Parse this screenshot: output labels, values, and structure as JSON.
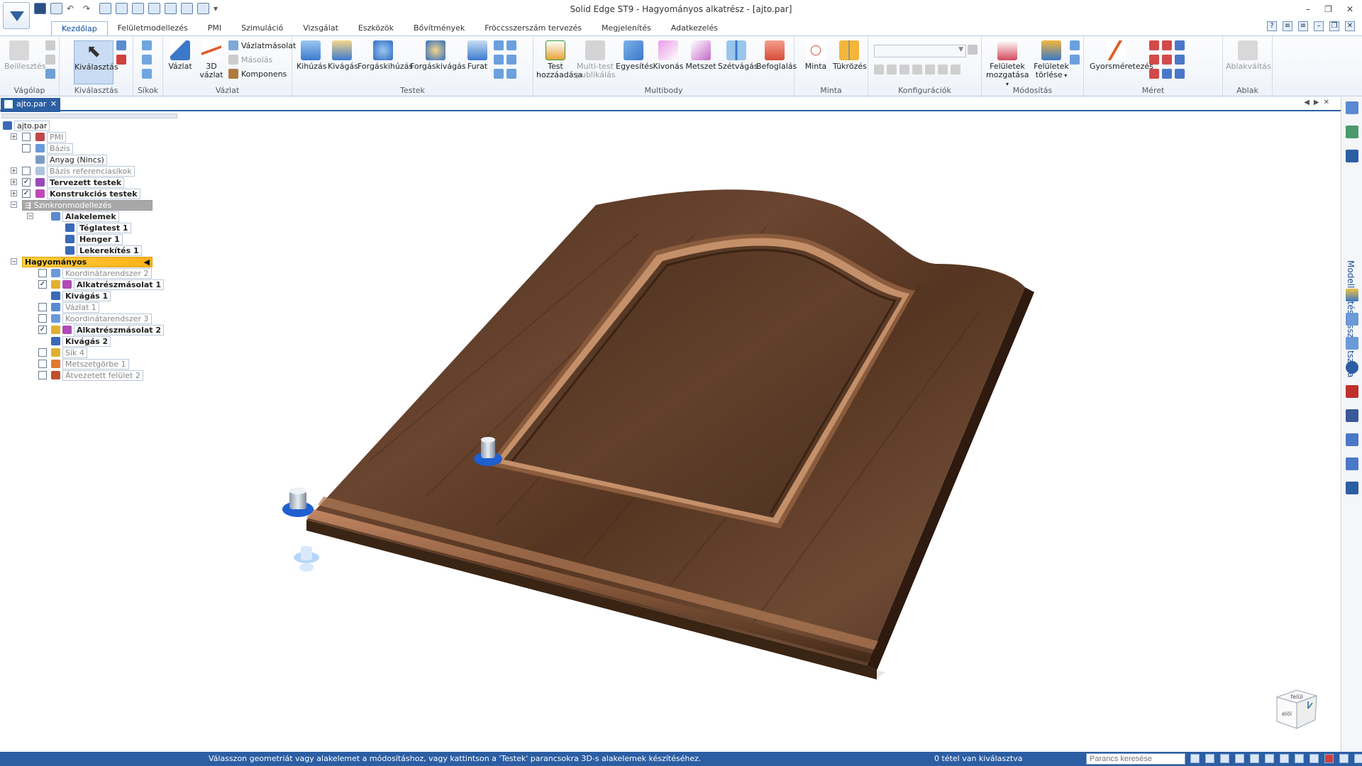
{
  "window": {
    "title": "Solid Edge ST9 - Hagyományos alkatrész - [ajto.par]"
  },
  "tabs": [
    "Kezdőlap",
    "Felületmodellezés",
    "PMI",
    "Szimuláció",
    "Vizsgálat",
    "Eszközök",
    "Bővítmények",
    "Fröccsszerszám tervezés",
    "Megjelenítés",
    "Adatkezelés"
  ],
  "ribbon": {
    "groups": {
      "clipboard": "Vágólap",
      "select": "Kiválasztás",
      "planes": "Síkok",
      "sketch": "Vázlat",
      "solids": "Testek",
      "multibody": "Multibody",
      "pattern": "Minta",
      "configs": "Konfigurációk",
      "modify": "Módosítás",
      "dimension": "Méret",
      "window": "Ablak"
    },
    "buttons": {
      "paste": "Beillesztés",
      "select": "Kiválasztás",
      "sketch": "Vázlat",
      "sketch3d_l1": "3D",
      "sketch3d_l2": "vázlat",
      "sketch_copy": "Vázlatmásolat",
      "copy": "Másolás",
      "component": "Komponens",
      "extrude": "Kihúzás",
      "cut": "Kivágás",
      "revolve": "Forgáskihúzás",
      "revolve_cut": "Forgáskivágás",
      "hole": "Furat",
      "add_body_l1": "Test",
      "add_body_l2": "hozzáadása",
      "publish_l1": "Multi-test",
      "publish_l2": "publikálás",
      "union": "Egyesítés",
      "subtract": "Kivonás",
      "intersect": "Metszet",
      "split": "Szétvágás",
      "enclose": "Befoglalás",
      "pattern": "Minta",
      "mirror": "Tükrözés",
      "move_faces_l1": "Felületek",
      "move_faces_l2": "mozgatása",
      "delete_faces_l1": "Felületek",
      "delete_faces_l2": "törlése",
      "smart_dim": "Gyorsméretezés",
      "switch_win": "Ablakváltás"
    }
  },
  "document_tab": {
    "name": "ajto.par"
  },
  "tree": {
    "root": "ajto.par",
    "pmi": "PMI",
    "base": "Bázis",
    "material": "Anyag (Nincs)",
    "base_refs": "Bázis referenciasíkok",
    "design_bodies": "Tervezett testek",
    "construction_bodies": "Konstrukciós testek",
    "sync": "Szinkronmodellezés",
    "features": "Alakelemek",
    "box": "Téglatest 1",
    "cylinder": "Henger 1",
    "round": "Lekerekítés 1",
    "traditional": "Hagyományos",
    "cs2": "Koordinátarendszer 2",
    "partcopy1": "Alkatrészmásolat 1",
    "cut1": "Kivágás 1",
    "sketch1": "Vázlat 1",
    "cs3": "Koordinátarendszer 3",
    "partcopy2": "Alkatrészmásolat 2",
    "cut2": "Kivágás 2",
    "plane4": "Sík 4",
    "intersection_curve": "Metszetgörbe 1",
    "offset_surface": "Átvezetett felület 2"
  },
  "right_panel": {
    "label": "Modellépítés visszajátszása"
  },
  "status": {
    "message": "Válasszon geometriát vagy alakelemet a módosításhoz, vagy kattintson a 'Testek' parancsokra 3D-s alakelemek készítéséhez.",
    "selection": "0 tétel van kiválasztva",
    "search_placeholder": "Parancs keresése"
  },
  "viewcube": {
    "top": "felül",
    "front": "elöl"
  },
  "colors": {
    "accent": "#2c5ea3",
    "wood": "#5b3a22",
    "highlight": "#ffb21a"
  }
}
